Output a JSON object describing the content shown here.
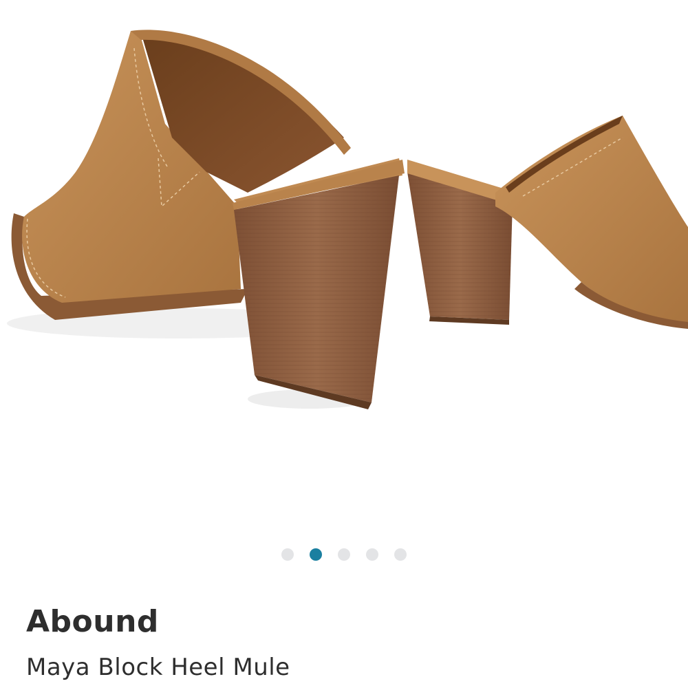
{
  "product": {
    "brand": "Abound",
    "name": "Maya Block Heel Mule"
  },
  "gallery": {
    "total_images": 5,
    "active_index": 1,
    "dot_color": "#e3e4e6",
    "active_dot_color": "#1a7fa0"
  },
  "colors": {
    "leather": "#c08a52",
    "leather_dark": "#9c6a3a",
    "heel_wood": "#8a5a3c",
    "lining": "#7a4a24"
  }
}
